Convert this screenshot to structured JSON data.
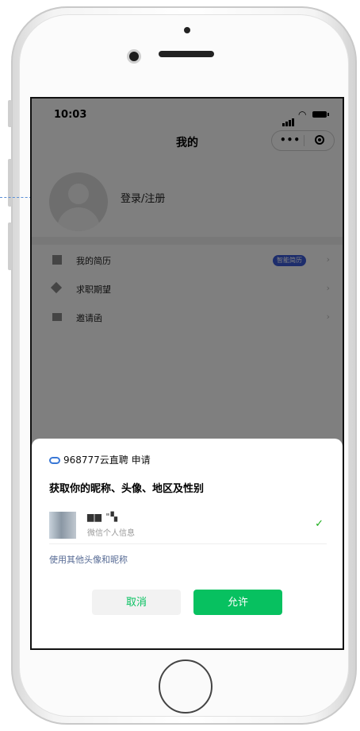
{
  "status_bar": {
    "time": "10:03"
  },
  "navbar": {
    "title": "我的",
    "more_icon": "more-dots-icon",
    "close_icon": "target-circle-icon"
  },
  "profile": {
    "login_text": "登录/注册",
    "avatar_icon": "default-avatar-icon"
  },
  "menu": [
    {
      "label": "我的简历",
      "badge": "智能简历",
      "icon": "resume-icon"
    },
    {
      "label": "求职期望",
      "badge": "",
      "icon": "diamond-icon"
    },
    {
      "label": "邀请函",
      "badge": "",
      "icon": "letter-icon"
    }
  ],
  "auth_sheet": {
    "header": "968777云直聘 申请",
    "title": "获取你的昵称、头像、地区及性别",
    "user_name": "▆▆ \"▚",
    "user_sub": "微信个人信息",
    "other_link": "使用其他头像和昵称",
    "cancel": "取消",
    "allow": "允许"
  },
  "colors": {
    "wechat_green": "#07c160",
    "link_blue": "#576b95",
    "badge_blue": "#3a5bd9"
  }
}
